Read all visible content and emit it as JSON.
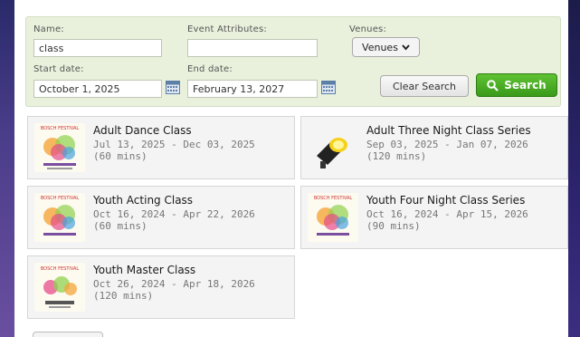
{
  "search": {
    "name_label": "Name:",
    "name_value": "class",
    "attributes_label": "Event Attributes:",
    "attributes_value": "",
    "venues_label": "Venues:",
    "venues_button": "Venues",
    "start_label": "Start date:",
    "start_value": "October 1, 2025",
    "end_label": "End date:",
    "end_value": "February 13, 2027",
    "clear_button": "Clear Search",
    "search_button": "Search"
  },
  "events": [
    {
      "title": "Adult Dance Class",
      "dates": "Jul 13, 2025 -  Dec 03, 2025",
      "duration": "(60 mins)",
      "thumb": "dance-flyer"
    },
    {
      "title": "Adult Three Night Class Series",
      "dates": "Sep 03, 2025 -  Jan 07, 2026",
      "duration": "(120 mins)",
      "thumb": "spotlight"
    },
    {
      "title": "Youth Acting Class",
      "dates": "Oct 16, 2024 -  Apr 22, 2026",
      "duration": "(60 mins)",
      "thumb": "dance-flyer"
    },
    {
      "title": "Youth Four Night Class Series",
      "dates": "Oct 16, 2024 -  Apr 15, 2026",
      "duration": "(90 mins)",
      "thumb": "dance-flyer"
    },
    {
      "title": "Youth Master Class",
      "dates": "Oct 26, 2024 -  Apr 18, 2026",
      "duration": "(120 mins)",
      "thumb": "master-flyer"
    }
  ],
  "colors": {
    "search_bg": "#e9f1dc",
    "search_button": "#4cae24",
    "card_bg": "#f4f4f4",
    "frame": "#3a2f6e"
  }
}
